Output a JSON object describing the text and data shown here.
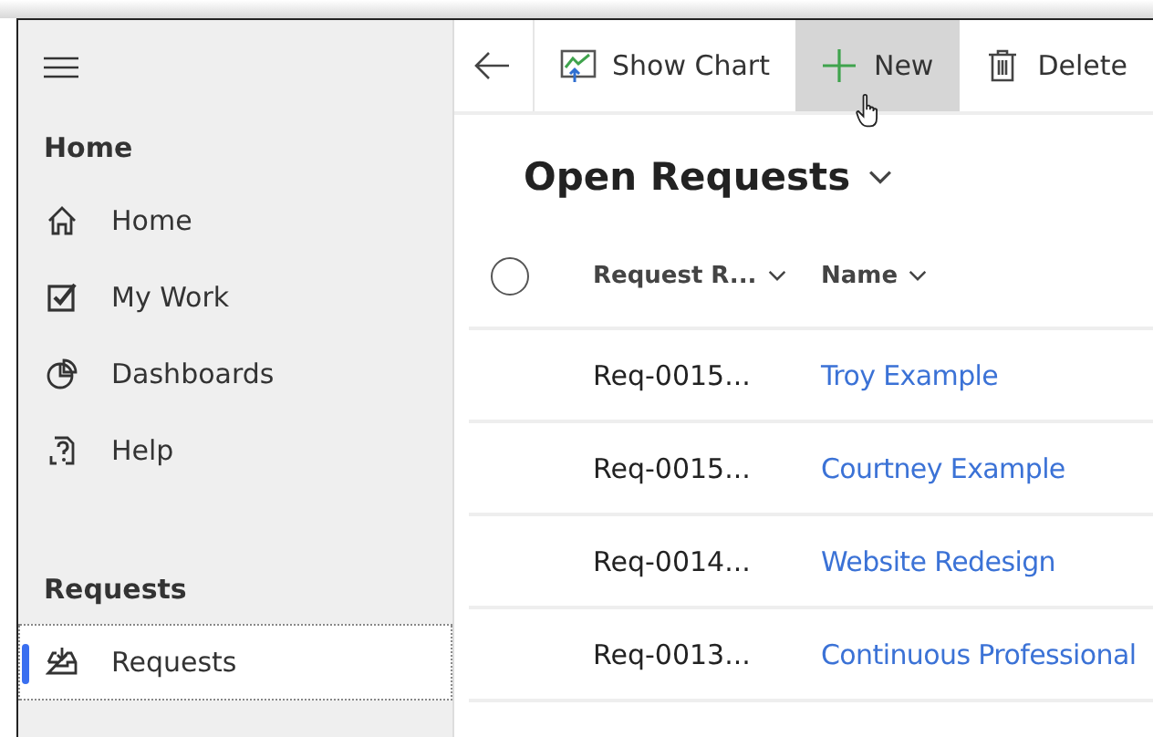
{
  "sidebar": {
    "sections": [
      {
        "heading": "Home",
        "items": [
          {
            "label": "Home",
            "kind": "home",
            "selected": false
          },
          {
            "label": "My Work",
            "kind": "check",
            "selected": false
          },
          {
            "label": "Dashboards",
            "kind": "pie",
            "selected": false
          },
          {
            "label": "Help",
            "kind": "help",
            "selected": false
          }
        ]
      },
      {
        "heading": "Requests",
        "items": [
          {
            "label": "Requests",
            "kind": "inbox",
            "selected": true
          }
        ]
      }
    ]
  },
  "toolbar": {
    "buttons": [
      {
        "label": "Show Chart",
        "kind": "chart",
        "hovered": false
      },
      {
        "label": "New",
        "kind": "plus",
        "hovered": true
      },
      {
        "label": "Delete",
        "kind": "trash",
        "hovered": false
      }
    ]
  },
  "view": {
    "title": "Open Requests",
    "selected_all": false
  },
  "table": {
    "columns": [
      "Request R...",
      "Name"
    ],
    "rows": [
      {
        "cells": [
          "Req-0015...",
          "Troy Example"
        ],
        "selected": false
      },
      {
        "cells": [
          "Req-0015...",
          "Courtney Example"
        ],
        "selected": false
      },
      {
        "cells": [
          "Req-0014...",
          "Website Redesign"
        ],
        "selected": false
      },
      {
        "cells": [
          "Req-0013...",
          "Continuous Professional"
        ],
        "selected": false
      }
    ]
  }
}
